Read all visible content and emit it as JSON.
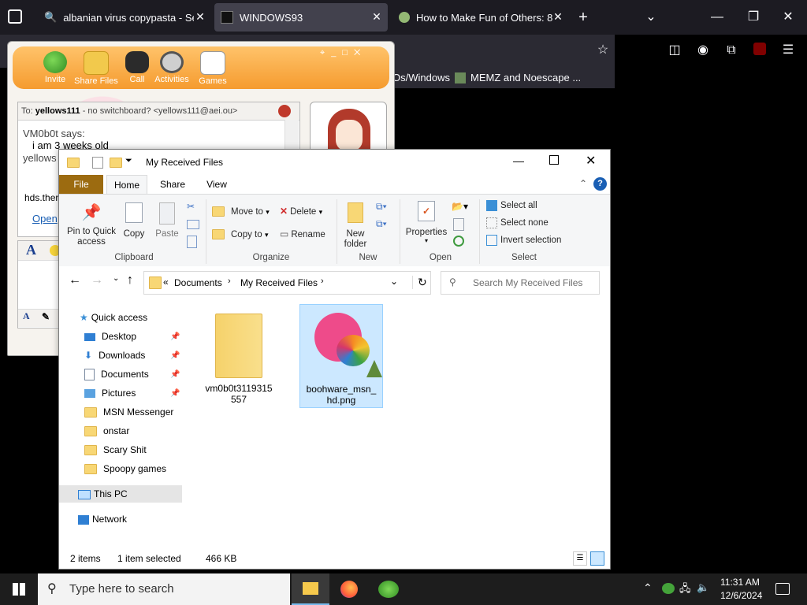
{
  "browser": {
    "tabs": [
      {
        "title": "albanian virus copypasta - Sear"
      },
      {
        "title": "WINDOWS93"
      },
      {
        "title": "How to Make Fun of Others: 8 \\"
      }
    ],
    "bookmarks": [
      {
        "label": "Os/Windows"
      },
      {
        "label": "MEMZ and Noescape ..."
      }
    ]
  },
  "msn": {
    "toolbar": [
      {
        "label": "Invite"
      },
      {
        "label": "Share Files"
      },
      {
        "label": "Call"
      },
      {
        "label": "Activities"
      },
      {
        "label": "Games"
      }
    ],
    "to_prefix": "To:",
    "to_name": "yellows111",
    "to_detail": "- no switchboard? <yellows111@aei.ou>",
    "messages": [
      {
        "text": "VM0b0t says:"
      },
      {
        "text": "i am 3 weeks old"
      },
      {
        "text": "yellows"
      }
    ],
    "link_prefix": "hds.ther",
    "open_link": "Open",
    "font_letter": "A"
  },
  "explorer": {
    "title": "My Received Files",
    "ribbon_tabs": [
      "File",
      "Home",
      "Share",
      "View"
    ],
    "clipboard": {
      "pin": "Pin to Quick access",
      "copy": "Copy",
      "paste": "Paste",
      "group": "Clipboard"
    },
    "organize": {
      "move_to": "Move to",
      "copy_to": "Copy to",
      "delete": "Delete",
      "rename": "Rename",
      "group": "Organize"
    },
    "new": {
      "new_folder": "New folder",
      "group": "New"
    },
    "open": {
      "properties": "Properties",
      "group": "Open"
    },
    "select": {
      "select_all": "Select all",
      "select_none": "Select none",
      "invert": "Invert selection",
      "group": "Select"
    },
    "breadcrumb": [
      "Documents",
      "My Received Files"
    ],
    "search_placeholder": "Search My Received Files",
    "nav": [
      {
        "label": "Quick access"
      },
      {
        "label": "Desktop"
      },
      {
        "label": "Downloads"
      },
      {
        "label": "Documents"
      },
      {
        "label": "Pictures"
      },
      {
        "label": "MSN Messenger"
      },
      {
        "label": "onstar"
      },
      {
        "label": "Scary Shit"
      },
      {
        "label": "Spoopy games"
      },
      {
        "label": "This PC"
      },
      {
        "label": "Network"
      }
    ],
    "files": [
      {
        "name": "vm0b0t3119315557"
      },
      {
        "name": "boohware_msn_hd.png"
      }
    ],
    "status": {
      "items": "2 items",
      "selected": "1 item selected",
      "size": "466 KB"
    }
  },
  "taskbar": {
    "search_placeholder": "Type here to search",
    "time": "11:31 AM",
    "date": "12/6/2024"
  }
}
